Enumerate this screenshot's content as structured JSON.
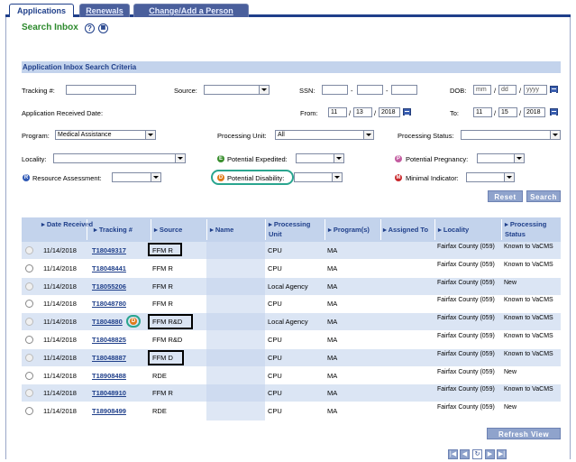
{
  "tabs": [
    {
      "label": "Applications"
    },
    {
      "label": "Renewals"
    },
    {
      "label": "Change/Add a Person"
    }
  ],
  "header": {
    "title": "Search Inbox",
    "help_icon": "?",
    "grid_icon": "grid-icon"
  },
  "criteria": {
    "section_title": "Application Inbox Search Criteria",
    "tracking_label": "Tracking #:",
    "tracking_value": "",
    "source_label": "Source:",
    "source_value": "",
    "ssn_label": "SSN:",
    "ssn_sep": "-",
    "dob_label": "DOB:",
    "dob_mm": "mm",
    "dob_dd": "dd",
    "dob_yyyy": "yyyy",
    "date_received_label": "Application Received Date:",
    "from_label": "From:",
    "from_mm": "11",
    "from_dd": "13",
    "from_yyyy": "2018",
    "to_label": "To:",
    "to_mm": "11",
    "to_dd": "15",
    "to_yyyy": "2018",
    "slash": "/",
    "program_label": "Program:",
    "program_value": "Medical Assistance",
    "processing_unit_label": "Processing Unit:",
    "processing_unit_value": "All",
    "processing_status_label": "Processing Status:",
    "processing_status_value": "",
    "locality_label": "Locality:",
    "locality_value": "",
    "potential_expedited_label": "Potential Expedited:",
    "potential_expedited_badge": "E",
    "potential_pregnancy_label": "Potential Pregnancy:",
    "potential_pregnancy_badge": "P",
    "resource_assessment_label": "Resource Assessment:",
    "resource_assessment_badge": "R",
    "potential_disability_label": "Potential Disability:",
    "potential_disability_badge": "D",
    "minimal_indicator_label": "Minimal Indicator:",
    "minimal_indicator_badge": "M",
    "reset_label": "Reset",
    "search_label": "Search"
  },
  "colors": {
    "expedited": "#3a8f2e",
    "pregnancy": "#c35ca0",
    "resource": "#2f59b5",
    "disability": "#e07a1a",
    "minimal": "#c9272b"
  },
  "table": {
    "columns": [
      "Date Received",
      "Tracking #",
      "Source",
      "Name",
      "Processing Unit",
      "Program(s)",
      "Assigned To",
      "Locality",
      "Processing Status"
    ],
    "rows": [
      {
        "date": "11/14/2018",
        "tracking": "T18049317",
        "source": "FFM R",
        "name": "",
        "unit": "CPU",
        "program": "MA",
        "assigned": "",
        "locality": "Fairfax County (059)",
        "status": "Known to VaCMS"
      },
      {
        "date": "11/14/2018",
        "tracking": "T18048441",
        "source": "FFM R",
        "name": "",
        "unit": "CPU",
        "program": "MA",
        "assigned": "",
        "locality": "Fairfax County (059)",
        "status": "Known to VaCMS"
      },
      {
        "date": "11/14/2018",
        "tracking": "T18055206",
        "source": "FFM R",
        "name": "",
        "unit": "Local Agency",
        "program": "MA",
        "assigned": "",
        "locality": "Fairfax County (059)",
        "status": "New"
      },
      {
        "date": "11/14/2018",
        "tracking": "T18048780",
        "source": "FFM R",
        "name": "",
        "unit": "CPU",
        "program": "MA",
        "assigned": "",
        "locality": "Fairfax County (059)",
        "status": "Known to VaCMS"
      },
      {
        "date": "11/14/2018",
        "tracking": "T1804880",
        "source": "FFM R&D",
        "name": "",
        "unit": "Local Agency",
        "program": "MA",
        "assigned": "",
        "locality": "Fairfax County (059)",
        "status": "Known to VaCMS"
      },
      {
        "date": "11/14/2018",
        "tracking": "T18048825",
        "source": "FFM R&D",
        "name": "",
        "unit": "CPU",
        "program": "MA",
        "assigned": "",
        "locality": "Fairfax County (059)",
        "status": "Known to VaCMS"
      },
      {
        "date": "11/14/2018",
        "tracking": "T18048887",
        "source": "FFM D",
        "name": "",
        "unit": "CPU",
        "program": "MA",
        "assigned": "",
        "locality": "Fairfax County (059)",
        "status": "Known to VaCMS"
      },
      {
        "date": "11/14/2018",
        "tracking": "T18908488",
        "source": "RDE",
        "name": "",
        "unit": "CPU",
        "program": "MA",
        "assigned": "",
        "locality": "Fairfax County (059)",
        "status": "New"
      },
      {
        "date": "11/14/2018",
        "tracking": "T18048910",
        "source": "FFM R",
        "name": "",
        "unit": "CPU",
        "program": "MA",
        "assigned": "",
        "locality": "Fairfax County (059)",
        "status": "Known to VaCMS"
      },
      {
        "date": "11/14/2018",
        "tracking": "T18908499",
        "source": "RDE",
        "name": "",
        "unit": "CPU",
        "program": "MA",
        "assigned": "",
        "locality": "Fairfax County (059)",
        "status": "New"
      }
    ],
    "row_badge": "D",
    "refresh_label": "Refresh View"
  },
  "pager": {
    "first": "|◀",
    "prev": "◀",
    "refresh": "↻",
    "next": "▶",
    "last": "▶|"
  }
}
